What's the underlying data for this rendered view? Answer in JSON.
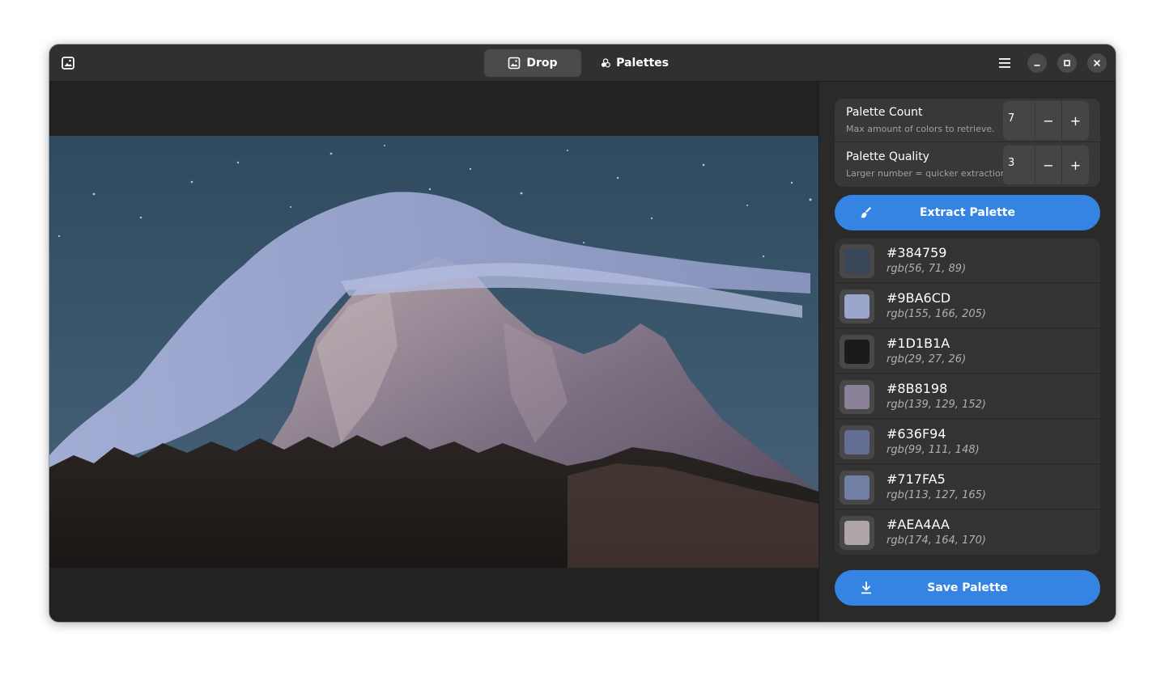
{
  "header": {
    "tabs": [
      {
        "label": "Drop",
        "icon": "image-icon",
        "active": true
      },
      {
        "label": "Palettes",
        "icon": "palettes-icon",
        "active": false
      }
    ],
    "icons": [
      "app-image-icon",
      "hamburger-menu-icon",
      "minimize-icon",
      "maximize-icon",
      "close-icon"
    ]
  },
  "settings": {
    "count": {
      "title": "Palette Count",
      "subtitle": "Max amount of colors to retrieve.",
      "value": "7"
    },
    "quality": {
      "title": "Palette Quality",
      "subtitle": "Larger number = quicker extraction.",
      "value": "3"
    },
    "minus_symbol": "−",
    "plus_symbol": "+"
  },
  "actions": {
    "extract_label": "Extract Palette",
    "save_label": "Save Palette"
  },
  "palette": [
    {
      "hex": "#384759",
      "rgb": "rgb(56, 71, 89)"
    },
    {
      "hex": "#9BA6CD",
      "rgb": "rgb(155, 166, 205)"
    },
    {
      "hex": "#1D1B1A",
      "rgb": "rgb(29, 27, 26)"
    },
    {
      "hex": "#8B8198",
      "rgb": "rgb(139, 129, 152)"
    },
    {
      "hex": "#636F94",
      "rgb": "rgb(99, 111, 148)"
    },
    {
      "hex": "#717FA5",
      "rgb": "rgb(113, 127, 165)"
    },
    {
      "hex": "#AEA4AA",
      "rgb": "rgb(174, 164, 170)"
    }
  ],
  "colors": {
    "accent": "#3584e4",
    "window_bg": "#242424",
    "headerbar_bg": "#303030"
  }
}
